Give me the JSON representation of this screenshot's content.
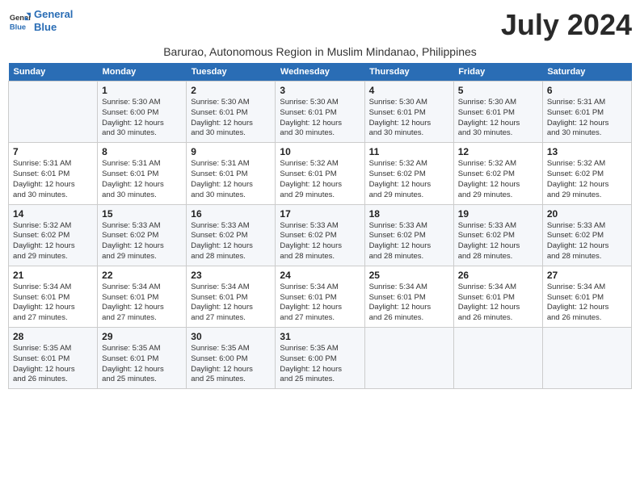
{
  "header": {
    "logo_line1": "General",
    "logo_line2": "Blue",
    "month_title": "July 2024",
    "subtitle": "Barurao, Autonomous Region in Muslim Mindanao, Philippines"
  },
  "weekdays": [
    "Sunday",
    "Monday",
    "Tuesday",
    "Wednesday",
    "Thursday",
    "Friday",
    "Saturday"
  ],
  "weeks": [
    [
      {
        "day": "",
        "info": ""
      },
      {
        "day": "1",
        "info": "Sunrise: 5:30 AM\nSunset: 6:00 PM\nDaylight: 12 hours\nand 30 minutes."
      },
      {
        "day": "2",
        "info": "Sunrise: 5:30 AM\nSunset: 6:01 PM\nDaylight: 12 hours\nand 30 minutes."
      },
      {
        "day": "3",
        "info": "Sunrise: 5:30 AM\nSunset: 6:01 PM\nDaylight: 12 hours\nand 30 minutes."
      },
      {
        "day": "4",
        "info": "Sunrise: 5:30 AM\nSunset: 6:01 PM\nDaylight: 12 hours\nand 30 minutes."
      },
      {
        "day": "5",
        "info": "Sunrise: 5:30 AM\nSunset: 6:01 PM\nDaylight: 12 hours\nand 30 minutes."
      },
      {
        "day": "6",
        "info": "Sunrise: 5:31 AM\nSunset: 6:01 PM\nDaylight: 12 hours\nand 30 minutes."
      }
    ],
    [
      {
        "day": "7",
        "info": "Sunrise: 5:31 AM\nSunset: 6:01 PM\nDaylight: 12 hours\nand 30 minutes."
      },
      {
        "day": "8",
        "info": "Sunrise: 5:31 AM\nSunset: 6:01 PM\nDaylight: 12 hours\nand 30 minutes."
      },
      {
        "day": "9",
        "info": "Sunrise: 5:31 AM\nSunset: 6:01 PM\nDaylight: 12 hours\nand 30 minutes."
      },
      {
        "day": "10",
        "info": "Sunrise: 5:32 AM\nSunset: 6:01 PM\nDaylight: 12 hours\nand 29 minutes."
      },
      {
        "day": "11",
        "info": "Sunrise: 5:32 AM\nSunset: 6:02 PM\nDaylight: 12 hours\nand 29 minutes."
      },
      {
        "day": "12",
        "info": "Sunrise: 5:32 AM\nSunset: 6:02 PM\nDaylight: 12 hours\nand 29 minutes."
      },
      {
        "day": "13",
        "info": "Sunrise: 5:32 AM\nSunset: 6:02 PM\nDaylight: 12 hours\nand 29 minutes."
      }
    ],
    [
      {
        "day": "14",
        "info": "Sunrise: 5:32 AM\nSunset: 6:02 PM\nDaylight: 12 hours\nand 29 minutes."
      },
      {
        "day": "15",
        "info": "Sunrise: 5:33 AM\nSunset: 6:02 PM\nDaylight: 12 hours\nand 29 minutes."
      },
      {
        "day": "16",
        "info": "Sunrise: 5:33 AM\nSunset: 6:02 PM\nDaylight: 12 hours\nand 28 minutes."
      },
      {
        "day": "17",
        "info": "Sunrise: 5:33 AM\nSunset: 6:02 PM\nDaylight: 12 hours\nand 28 minutes."
      },
      {
        "day": "18",
        "info": "Sunrise: 5:33 AM\nSunset: 6:02 PM\nDaylight: 12 hours\nand 28 minutes."
      },
      {
        "day": "19",
        "info": "Sunrise: 5:33 AM\nSunset: 6:02 PM\nDaylight: 12 hours\nand 28 minutes."
      },
      {
        "day": "20",
        "info": "Sunrise: 5:33 AM\nSunset: 6:02 PM\nDaylight: 12 hours\nand 28 minutes."
      }
    ],
    [
      {
        "day": "21",
        "info": "Sunrise: 5:34 AM\nSunset: 6:01 PM\nDaylight: 12 hours\nand 27 minutes."
      },
      {
        "day": "22",
        "info": "Sunrise: 5:34 AM\nSunset: 6:01 PM\nDaylight: 12 hours\nand 27 minutes."
      },
      {
        "day": "23",
        "info": "Sunrise: 5:34 AM\nSunset: 6:01 PM\nDaylight: 12 hours\nand 27 minutes."
      },
      {
        "day": "24",
        "info": "Sunrise: 5:34 AM\nSunset: 6:01 PM\nDaylight: 12 hours\nand 27 minutes."
      },
      {
        "day": "25",
        "info": "Sunrise: 5:34 AM\nSunset: 6:01 PM\nDaylight: 12 hours\nand 26 minutes."
      },
      {
        "day": "26",
        "info": "Sunrise: 5:34 AM\nSunset: 6:01 PM\nDaylight: 12 hours\nand 26 minutes."
      },
      {
        "day": "27",
        "info": "Sunrise: 5:34 AM\nSunset: 6:01 PM\nDaylight: 12 hours\nand 26 minutes."
      }
    ],
    [
      {
        "day": "28",
        "info": "Sunrise: 5:35 AM\nSunset: 6:01 PM\nDaylight: 12 hours\nand 26 minutes."
      },
      {
        "day": "29",
        "info": "Sunrise: 5:35 AM\nSunset: 6:01 PM\nDaylight: 12 hours\nand 25 minutes."
      },
      {
        "day": "30",
        "info": "Sunrise: 5:35 AM\nSunset: 6:00 PM\nDaylight: 12 hours\nand 25 minutes."
      },
      {
        "day": "31",
        "info": "Sunrise: 5:35 AM\nSunset: 6:00 PM\nDaylight: 12 hours\nand 25 minutes."
      },
      {
        "day": "",
        "info": ""
      },
      {
        "day": "",
        "info": ""
      },
      {
        "day": "",
        "info": ""
      }
    ]
  ]
}
